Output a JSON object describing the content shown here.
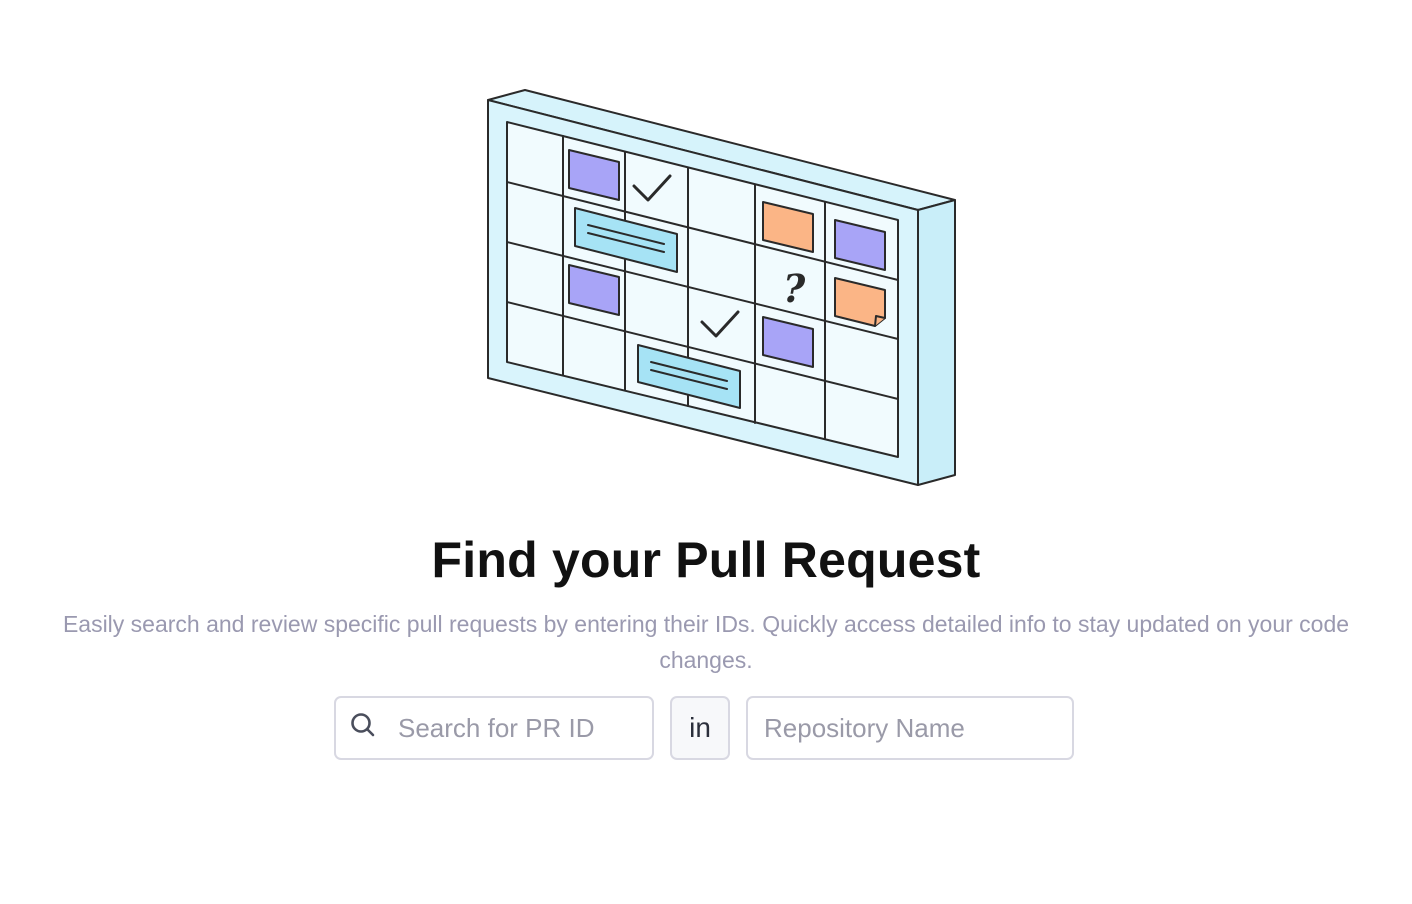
{
  "heading": {
    "title": "Find your Pull Request",
    "subtitle": "Easily search and review specific pull requests by entering their IDs. Quickly access detailed info to stay updated on your code changes."
  },
  "search": {
    "pr_id_placeholder": "Search for PR ID",
    "pr_id_value": "",
    "connector_label": "in",
    "repo_placeholder": "Repository Name",
    "repo_value": ""
  },
  "illustration": {
    "question_mark": "?"
  },
  "colors": {
    "board_fill": "#d6f3fb",
    "cell_fill": "#eef9fd",
    "purple_card": "#a8a4f7",
    "blue_card": "#a6e3f5",
    "orange_card": "#fbb586",
    "outline": "#2a2a2a",
    "title": "#111111",
    "subtitle": "#9a99b0",
    "border": "#d8d8e2"
  },
  "icons": {
    "search": "search-icon",
    "check": "checkmark-icon"
  }
}
